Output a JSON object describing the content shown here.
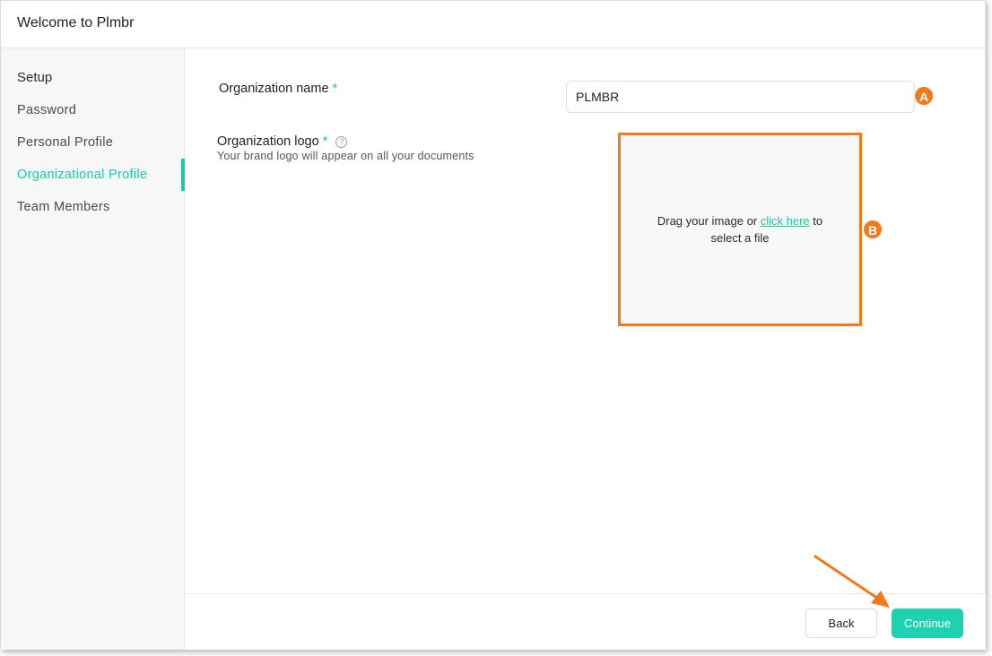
{
  "window": {
    "title": "Welcome to Plmbr"
  },
  "sidebar": {
    "heading": "Setup",
    "items": [
      {
        "label": "Password",
        "active": false
      },
      {
        "label": "Personal Profile",
        "active": false
      },
      {
        "label": "Organizational Profile",
        "active": true
      },
      {
        "label": "Team Members",
        "active": false
      }
    ]
  },
  "form": {
    "org_name": {
      "label": "Organization name",
      "required_marker": "*",
      "value": "PLMBR",
      "placeholder": ""
    },
    "org_logo": {
      "label": "Organization logo",
      "required_marker": "*",
      "help_icon": "?",
      "description": "Your brand logo will appear on all your documents",
      "dropzone_prefix": "Drag your image or ",
      "dropzone_link": "click here",
      "dropzone_suffix": " to select a file"
    }
  },
  "annotations": {
    "badge_a": "A",
    "badge_b": "B",
    "color": "#f07a1c"
  },
  "footer": {
    "back_label": "Back",
    "continue_label": "Continue"
  },
  "colors": {
    "accent": "#1ec8a5",
    "continue_button": "#1ed2b1",
    "annotation": "#f07a1c"
  }
}
